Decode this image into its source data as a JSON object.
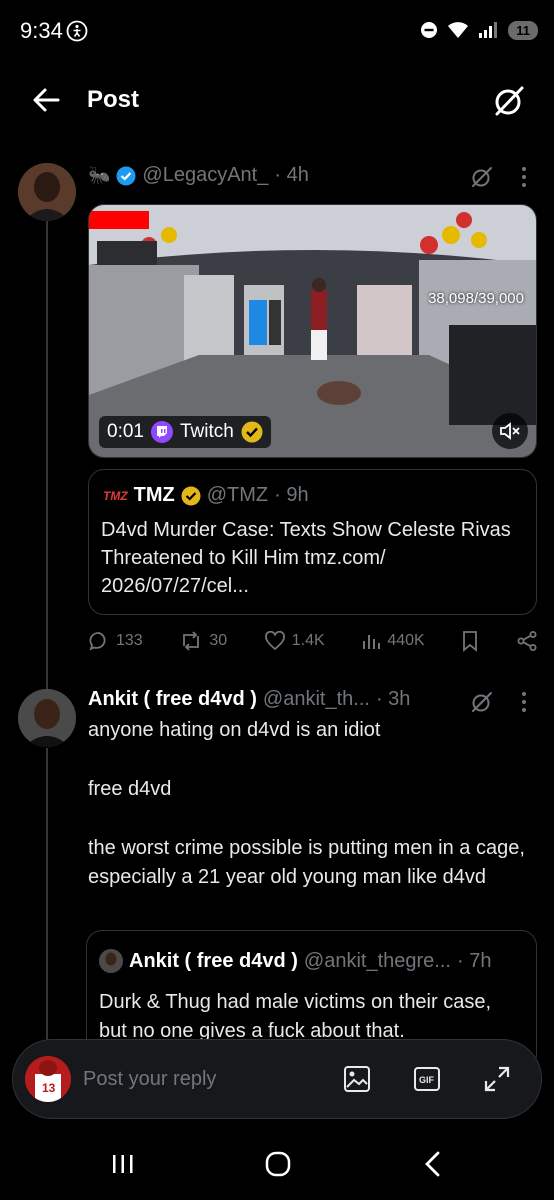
{
  "status": {
    "time": "9:34",
    "battery": "11"
  },
  "header": {
    "title": "Post"
  },
  "main_post": {
    "handle": "@LegacyAnt_",
    "time": "· 4h",
    "video": {
      "time": "0:01",
      "source": "Twitch",
      "overlay_count": "38,098/39,000"
    },
    "quote": {
      "name": "TMZ",
      "handle": "@TMZ",
      "time": "· 9h",
      "text": "D4vd Murder Case: Texts Show Celeste Rivas Threatened to Kill Him tmz.com/ 2026/07/27/cel..."
    },
    "stats": {
      "replies": "133",
      "reposts": "30",
      "likes": "1.4K",
      "views": "440K"
    }
  },
  "reply": {
    "name": "Ankit ( free d4vd )",
    "handle": "@ankit_th...",
    "time": "· 3h",
    "lines": [
      "anyone hating on d4vd is an idiot",
      "free d4vd",
      "the worst crime possible is putting men in a cage, especially a 21 year old young man like d4vd"
    ],
    "quote": {
      "name": "Ankit ( free d4vd )",
      "handle": "@ankit_thegre...",
      "time": "· 7h",
      "text": "Durk & Thug had male victims on their case, but no one gives a fuck about that."
    }
  },
  "reply_bar": {
    "placeholder": "Post your reply"
  },
  "colors": {
    "accent": "#1d9bf0",
    "verified_gold": "#e2b719",
    "twitch": "#9146ff",
    "background": "#000000"
  }
}
